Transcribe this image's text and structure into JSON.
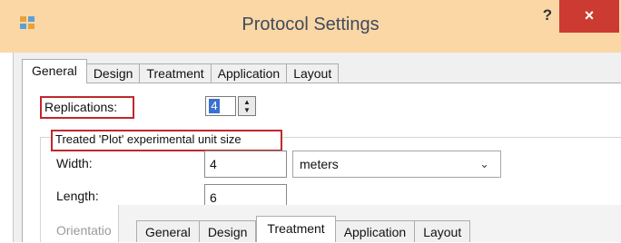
{
  "window": {
    "title": "Protocol Settings",
    "help_label": "?",
    "close_label": "×"
  },
  "tabs": [
    {
      "label": "General",
      "active": true
    },
    {
      "label": "Design",
      "active": false
    },
    {
      "label": "Treatment",
      "active": false
    },
    {
      "label": "Application",
      "active": false
    },
    {
      "label": "Layout",
      "active": false
    }
  ],
  "form": {
    "replications_label": "Replications:",
    "replications_value": "4",
    "spin_up": "▲",
    "spin_down": "▼",
    "group_title": "Treated 'Plot' experimental unit size",
    "width_label": "Width:",
    "width_value": "4",
    "units_value": "meters",
    "chevron": "⌄",
    "length_label": "Length:",
    "length_value": "6",
    "orientation_label_partial": "Orientatio"
  },
  "overlay_tabs": [
    {
      "label": "General",
      "active": false
    },
    {
      "label": "Design",
      "active": false
    },
    {
      "label": "Treatment",
      "active": true
    },
    {
      "label": "Application",
      "active": false
    },
    {
      "label": "Layout",
      "active": false
    }
  ],
  "colors": {
    "titlebar": "#fbd7a6",
    "close": "#cc3b32",
    "highlight_box": "#c1272d",
    "selection": "#3b70d0"
  }
}
